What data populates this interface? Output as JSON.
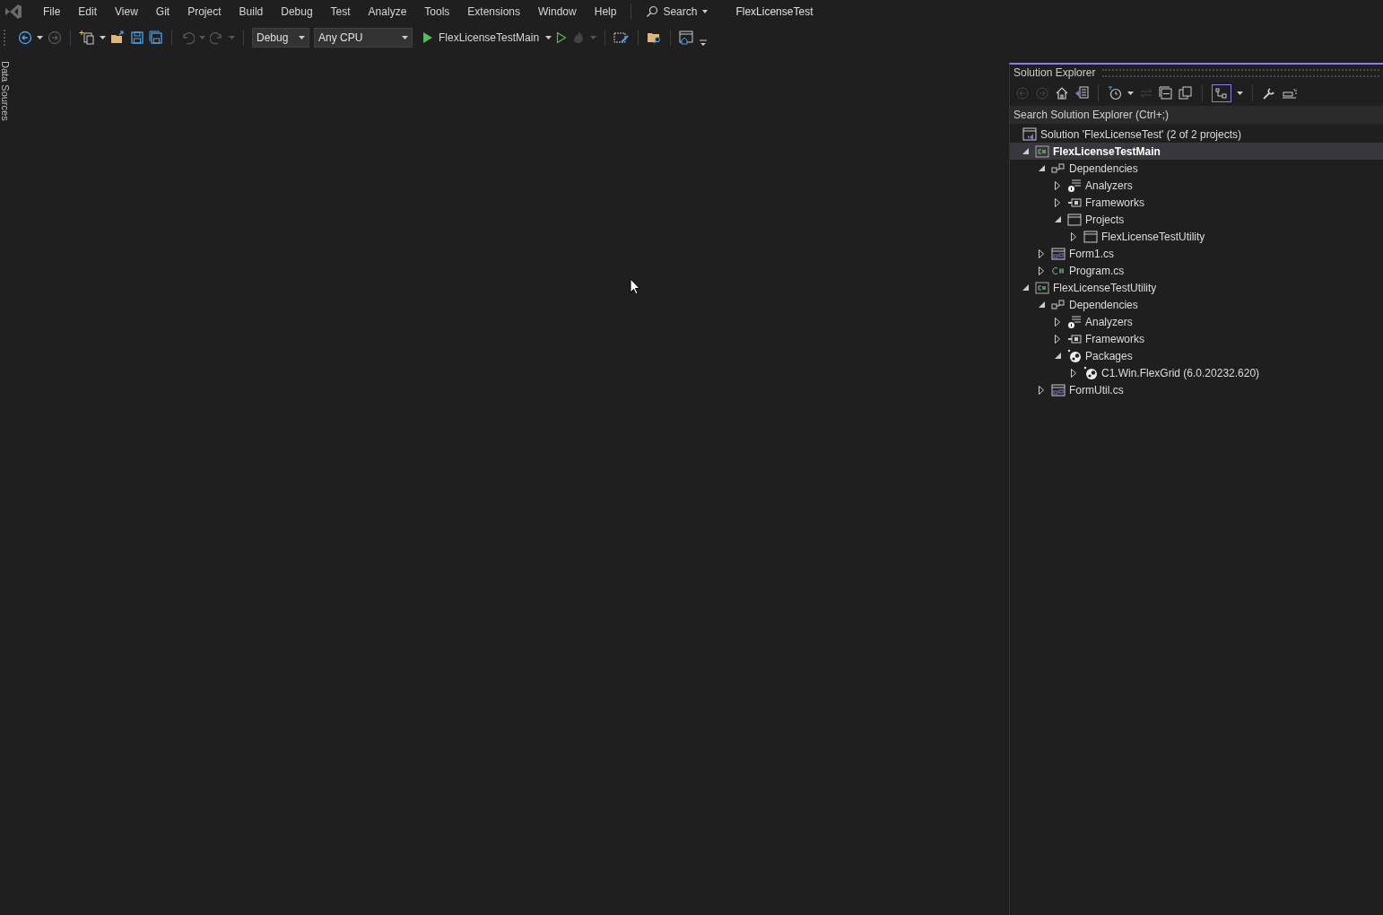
{
  "menu": [
    "File",
    "Edit",
    "View",
    "Git",
    "Project",
    "Build",
    "Debug",
    "Test",
    "Analyze",
    "Tools",
    "Extensions",
    "Window",
    "Help"
  ],
  "search_button": "Search",
  "window_title": "FlexLicenseTest",
  "toolbar": {
    "configuration": "Debug",
    "platform": "Any CPU",
    "start_target": "FlexLicenseTestMain"
  },
  "left_tab": "Data Sources",
  "solution_explorer": {
    "title": "Solution Explorer",
    "search": {
      "placeholder": "Search Solution Explorer (Ctrl+;)"
    },
    "solution": {
      "label": "Solution 'FlexLicenseTest' (2 of 2 projects)",
      "kind": "solution",
      "children": [
        {
          "label": "FlexLicenseTestMain",
          "kind": "csproj",
          "expanded": true,
          "selected": true,
          "startup": true,
          "children": [
            {
              "label": "Dependencies",
              "kind": "dependencies",
              "expanded": true,
              "selected": false,
              "children": [
                {
                  "label": "Analyzers",
                  "kind": "analyzers",
                  "expanded": false,
                  "selected": false
                },
                {
                  "label": "Frameworks",
                  "kind": "frameworks",
                  "expanded": false,
                  "selected": false
                },
                {
                  "label": "Projects",
                  "kind": "projects",
                  "expanded": true,
                  "selected": false,
                  "children": [
                    {
                      "label": "FlexLicenseTestUtility",
                      "kind": "projects",
                      "expanded": false,
                      "selected": false
                    }
                  ]
                }
              ]
            },
            {
              "label": "Form1.cs",
              "kind": "form",
              "expanded": false,
              "selected": false
            },
            {
              "label": "Program.cs",
              "kind": "csharp",
              "expanded": false,
              "selected": false
            }
          ]
        },
        {
          "label": "FlexLicenseTestUtility",
          "kind": "csproj",
          "expanded": true,
          "selected": false,
          "startup": false,
          "children": [
            {
              "label": "Dependencies",
              "kind": "dependencies",
              "expanded": true,
              "selected": false,
              "children": [
                {
                  "label": "Analyzers",
                  "kind": "analyzers",
                  "expanded": false,
                  "selected": false
                },
                {
                  "label": "Frameworks",
                  "kind": "frameworks",
                  "expanded": false,
                  "selected": false
                },
                {
                  "label": "Packages",
                  "kind": "packages",
                  "expanded": true,
                  "selected": false,
                  "children": [
                    {
                      "label": "C1.Win.FlexGrid (6.0.20232.620)",
                      "kind": "packages",
                      "expanded": false,
                      "selected": false
                    }
                  ]
                }
              ]
            },
            {
              "label": "FormUtil.cs",
              "kind": "form",
              "expanded": false,
              "selected": false
            }
          ]
        }
      ]
    }
  }
}
